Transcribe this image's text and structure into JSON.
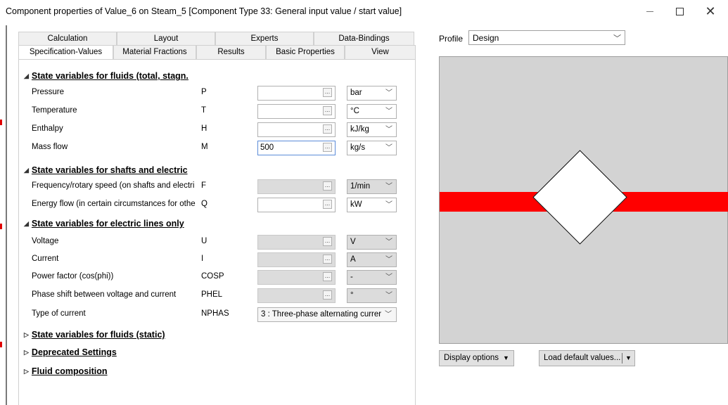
{
  "window": {
    "title": "Component properties of Value_6 on Steam_5  [Component Type 33: General input value / start value]",
    "minimize": "—",
    "close": "✕"
  },
  "tabs": {
    "row1": [
      "Calculation",
      "Layout",
      "Experts",
      "Data-Bindings"
    ],
    "row2": [
      "Specification-Values",
      "Material Fractions",
      "Results",
      "Basic Properties",
      "View"
    ],
    "active": "Specification-Values"
  },
  "sections": {
    "fluids_total": "State variables for fluids (total, stagn.",
    "shafts": "State variables for shafts and electric",
    "electric": "State variables for electric lines only",
    "fluids_static": "State variables for fluids (static)",
    "deprecated": "Deprecated Settings",
    "fluid_composition": "Fluid composition"
  },
  "rows": {
    "pressure": {
      "label": "Pressure",
      "symbol": "P",
      "value": "",
      "unit": "bar"
    },
    "temperature": {
      "label": "Temperature",
      "symbol": "T",
      "value": "",
      "unit": "°C"
    },
    "enthalpy": {
      "label": "Enthalpy",
      "symbol": "H",
      "value": "",
      "unit": "kJ/kg"
    },
    "massflow": {
      "label": "Mass flow",
      "symbol": "M",
      "value": "500",
      "unit": "kg/s"
    },
    "frequency": {
      "label": "Frequency/rotary speed (on shafts and electri",
      "symbol": "F",
      "value": "",
      "unit": "1/min"
    },
    "energyflow": {
      "label": "Energy flow (in certain circumstances for othe",
      "symbol": "Q",
      "value": "",
      "unit": "kW"
    },
    "voltage": {
      "label": "Voltage",
      "symbol": "U",
      "value": "",
      "unit": "V"
    },
    "current": {
      "label": "Current",
      "symbol": "I",
      "value": "",
      "unit": "A"
    },
    "powerfactor": {
      "label": "Power factor (cos(phi))",
      "symbol": "COSP",
      "value": "",
      "unit": "-"
    },
    "phaseshift": {
      "label": "Phase shift between voltage and current",
      "symbol": "PHEL",
      "value": "",
      "unit": "°"
    },
    "typecurrent": {
      "label": "Type of current",
      "symbol": "NPHAS",
      "value": "3 : Three-phase alternating currer"
    }
  },
  "ellipsis": "...",
  "right": {
    "profile_label": "Profile",
    "profile_value": "Design",
    "display_options": "Display options",
    "load_defaults": "Load default values..."
  },
  "colors": {
    "stream": "#ff0000",
    "preview_bg": "#d3d3d3"
  }
}
